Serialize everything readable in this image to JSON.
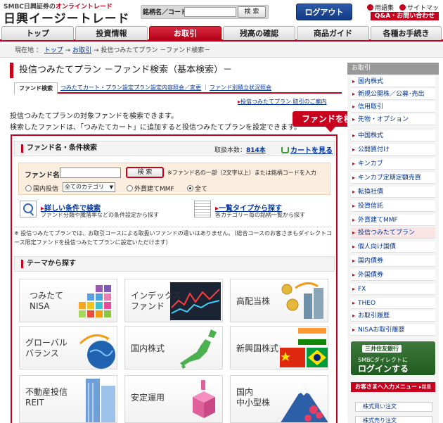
{
  "header": {
    "brand_sub_prefix": "SMBC日興証券の",
    "brand_sub_emph": "オンライントレード",
    "brand_main": "日興イージートレード",
    "search_label": "銘柄名／コード",
    "search_button": "検 索",
    "login_button": "ログアウト",
    "glossary": "用語集",
    "sitemap": "サイトマップ",
    "qa": "Q&A・お問い合わせ"
  },
  "gnav": {
    "tabs": [
      "トップ",
      "投資情報",
      "お取引",
      "残高の確認",
      "商品ガイド",
      "各種お手続き"
    ],
    "active_index": 2
  },
  "breadcrumb": {
    "prefix": "現在地 ：",
    "items": [
      "トップ",
      "お取引",
      "投信つみたてプラン －ファンド検索－"
    ],
    "sep": "→"
  },
  "page": {
    "title": "投信つみたてプラン －ファンド検索（基本検索）－",
    "subtabs": [
      "ファンド検索",
      "つみたてカート・プラン設定",
      "プラン設定内容照会／変更",
      "ファンド別積立状況照会"
    ],
    "intro_link": "投信つみたてプラン 取引のご案内",
    "intro_line1": "投信つみたてプランの対象ファンドを検索できます。",
    "intro_line2": "検索したファンドは、「つみたてカート」に追加すると投信つみたてプランを設定できます。",
    "badge": "ファンドを検索"
  },
  "search": {
    "section_title": "ファンド名・条件検索",
    "count_label": "取扱本数：",
    "count": "814本",
    "cart_link": "カートを見る",
    "fund_name_label": "ファンド名",
    "fund_name_value": "",
    "button": "検 索",
    "note": "※ファンド名の一部（2文字以上）または銘柄コードを入力",
    "radio_domestic": "国内投信",
    "category_selected": "全てのカテゴリ",
    "radio_foreign": "外貨建てMMF",
    "radio_all": "全て",
    "detail_link": "詳しい条件で検索",
    "detail_desc": "ファンド分類や騰落率などの条件設定から探す",
    "list_link": "一覧タイプから探す",
    "list_desc": "各カテゴリー毎の銘柄一覧から探す",
    "notice": "※ 投信つみたてプランでは、お取引コースによる取扱いファンドの違いはありません。（総合コースのお客さまもダイレクトコース限定ファンドを投信つみたてプランに設定いただけます）"
  },
  "themes": {
    "title": "テーマから探す",
    "tiles": [
      "つみたて\nNISA",
      "インデックス\nファンド",
      "高配当株",
      "グローバル\nバランス",
      "国内株式",
      "新興国株式",
      "不動産投信\nREIT",
      "安定運用",
      "国内\n中小型株"
    ]
  },
  "sidebar": {
    "head": "お取引",
    "items": [
      "国内株式",
      "新規公開株／公募･売出",
      "信用取引",
      "先物・オプション",
      "中国株式",
      "公開買付け",
      "キンカブ",
      "キンカブ定期定額売買",
      "転換社債",
      "投資信託",
      "外貨建てMMF",
      "投信つみたてプラン",
      "個人向け国債",
      "国内債券",
      "外国債券",
      "FX",
      "THEO",
      "お取引履歴",
      "NISAお取引履歴"
    ],
    "active_index": 11,
    "smbc_brand": "三井住友銀行",
    "smbc_sub": "SMBCダイレクトに",
    "smbc_login": "ログインする",
    "rec_title": "お客さまへ入力メニュー",
    "rec_close": "▸閉集",
    "rec_items": [
      "株式買い注文",
      "株式売り注文"
    ]
  },
  "colors": {
    "accent": "#c8001e",
    "link": "#003399",
    "login": "#1f4a96"
  }
}
